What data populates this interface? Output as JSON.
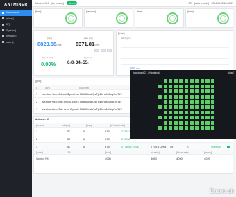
{
  "sidebar": {
    "logo": "ANTMINER",
    "items": [
      {
        "label": "Dashboard",
        "active": true
      },
      {
        "label": "[miner]",
        "active": false
      },
      {
        "label": "[IP]",
        "active": false
      },
      {
        "label": "[System]",
        "active": false
      },
      {
        "label": "[network]",
        "active": false
      },
      {
        "label": "[users]",
        "active": false
      }
    ]
  },
  "topbar": {
    "model": "Antminer S19",
    "firmware": "[fw version]",
    "status_pill": "Normal",
    "right_label": "[Auto refresh]",
    "datetime": "2024-06-22 18:00:51"
  },
  "status_panels": [
    {
      "label": "[fans]"
    },
    {
      "label": "[network]"
    },
    {
      "label": "[fans]"
    },
    {
      "label": "[temp]"
    }
  ],
  "hashrate": {
    "rt_label": "[rate]",
    "rt_value": "8823.58",
    "rt_unit": "GH/s",
    "avg_label": "[rate avg]",
    "avg_value": "8371.81",
    "avg_unit": "GH/s",
    "reject_label": "[reject rate]",
    "reject_value": "0.00%",
    "uptime_label": "[uptime]",
    "uptime_days": "0",
    "uptime_hours": "0",
    "uptime_minutes": "34",
    "uptime_seconds": "55"
  },
  "chart_panel": {
    "label": "[chart]",
    "legend": "[GH/s] [°C]"
  },
  "pools": {
    "label": "[pool]",
    "headers": [
      "#",
      "[url]",
      "[worker]"
    ],
    "rows": [
      {
        "index": "1",
        "url": "stratum+tcp://btcssl.f2pool.com:3333",
        "worker": "NHt6BcabQsTjxEkhaNiQdp3wTk7"
      },
      {
        "index": "2",
        "url": "stratum+tcp://btc.f2pool.com:3333",
        "worker": "NHt6BcabQsTjxEkhaNiQdp3wTk7"
      },
      {
        "index": "3",
        "url": "stratum+tcp://btc-euro.f2pool.com:3333",
        "worker": "NHt6BcabQsTjxEkhaNiQdp3wTk7"
      }
    ]
  },
  "chains": {
    "label": "Antminer K5",
    "headers": [
      "[board]",
      "[chips]",
      "[freq]",
      "[rt hashrate]"
    ],
    "rows": [
      {
        "board": "1",
        "chips": "50",
        "freq": "0",
        "extra": "675",
        "hashrate": "2786.1"
      },
      {
        "board": "2",
        "chips": "50",
        "freq": "0",
        "extra": "675",
        "hashrate": "2789.6"
      },
      {
        "board": "3",
        "chips": "50",
        "freq": "0",
        "extra": "675",
        "hashrate": "2778.96 GH/s",
        "ideal": "2794.5 GH/s",
        "temp_in": "48",
        "temp_out": "73",
        "status": "[normal]"
      }
    ],
    "total_label": "[total]",
    "total_chips": "151",
    "total_freq": "[freq]",
    "total_a": "[rt rate]",
    "total_b": "[ideal rate]",
    "total_c": "[temp]",
    "speed_label": "Speed (%)",
    "speed_a": "4050",
    "speed_b": "4080",
    "speed_c": "4090",
    "speed_d": "4020"
  },
  "modal": {
    "title": "[hashboard 2] - [chip status]",
    "action": "[close]"
  },
  "watermark": "Bazos.sk"
}
